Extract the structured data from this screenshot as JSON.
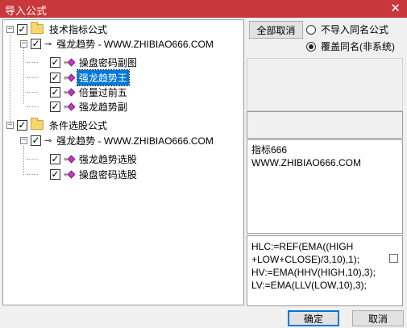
{
  "window": {
    "title": "导入公式",
    "close_glyph": "✕"
  },
  "tree": {
    "group1": {
      "label": "技术指标公式",
      "expander": "−",
      "package": {
        "label": "强龙趋势 - WWW.ZHIBIAO666.COM",
        "expander": "−",
        "items": [
          {
            "label": "操盘密码副图"
          },
          {
            "label": "强龙趋势王"
          },
          {
            "label": "倍量过前五"
          },
          {
            "label": "强龙趋势副"
          }
        ]
      }
    },
    "group2": {
      "label": "条件选股公式",
      "expander": "−",
      "package": {
        "label": "强龙趋势 - WWW.ZHIBIAO666.COM",
        "expander": "−",
        "items": [
          {
            "label": "强龙趋势选股"
          },
          {
            "label": "操盘密码选股"
          }
        ]
      }
    }
  },
  "options": {
    "cancel_all_label": "全部取消",
    "radio_no_import": "不导入同名公式",
    "radio_overwrite": "覆盖同名(非系统)"
  },
  "description": {
    "line1": "指标666",
    "line2": "WWW.ZHIBIAO666.COM"
  },
  "code": {
    "line1": "HLC:=REF(EMA((HIGH",
    "line2": "+LOW+CLOSE)/3,10),1);",
    "line3": "HV:=EMA(HHV(HIGH,10),3);",
    "line4": "LV:=EMA(LLV(LOW,10),3);"
  },
  "footer": {
    "ok_label": "确定",
    "cancel_label": "取消"
  },
  "icons": {
    "check": "✓",
    "key": "⊸",
    "lines": "≡"
  }
}
